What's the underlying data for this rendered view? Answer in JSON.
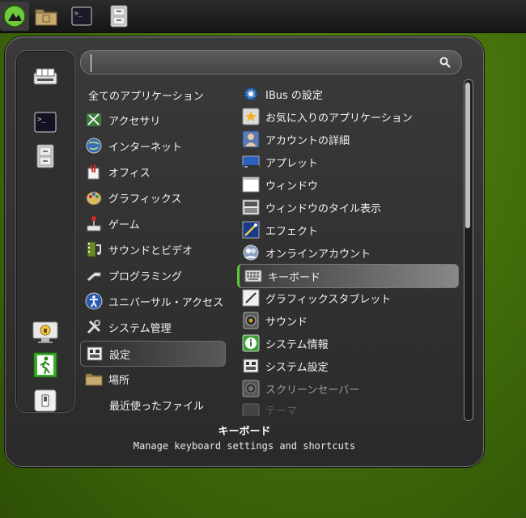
{
  "taskbar": {
    "buttons": [
      {
        "name": "menu-button",
        "icon": "mint-logo-icon"
      },
      {
        "name": "files-button",
        "icon": "folder-icon"
      },
      {
        "name": "terminal-button",
        "icon": "terminal-icon"
      },
      {
        "name": "file-cabinet-button",
        "icon": "file-cabinet-icon"
      }
    ]
  },
  "sidebar": {
    "items": [
      {
        "icon": "software-manager-icon"
      },
      {
        "icon": "terminal-icon"
      },
      {
        "icon": "file-cabinet-icon"
      },
      {
        "icon": "lock-screen-icon"
      },
      {
        "icon": "logout-icon"
      },
      {
        "icon": "shutdown-icon"
      }
    ]
  },
  "search": {
    "value": "",
    "placeholder": ""
  },
  "categories": [
    {
      "label": "全てのアプリケーション",
      "icon": ""
    },
    {
      "label": "アクセサリ",
      "icon": "accessories-icon"
    },
    {
      "label": "インターネット",
      "icon": "internet-globe-icon"
    },
    {
      "label": "オフィス",
      "icon": "office-icon"
    },
    {
      "label": "グラフィックス",
      "icon": "graphics-palette-icon"
    },
    {
      "label": "ゲーム",
      "icon": "games-joystick-icon"
    },
    {
      "label": "サウンドとビデオ",
      "icon": "multimedia-icon"
    },
    {
      "label": "プログラミング",
      "icon": "programming-icon"
    },
    {
      "label": "ユニバーサル・アクセス",
      "icon": "accessibility-icon"
    },
    {
      "label": "システム管理",
      "icon": "system-tools-icon"
    },
    {
      "label": "設定",
      "icon": "settings-icon"
    },
    {
      "label": "場所",
      "icon": "places-folder-icon"
    },
    {
      "label": "最近使ったファイル",
      "icon": ""
    }
  ],
  "apps": [
    {
      "label": "IBus の設定",
      "icon": "ibus-gear-icon"
    },
    {
      "label": "お気に入りのアプリケーション",
      "icon": "favorites-star-icon"
    },
    {
      "label": "アカウントの詳細",
      "icon": "account-icon"
    },
    {
      "label": "アプレット",
      "icon": "applets-icon"
    },
    {
      "label": "ウィンドウ",
      "icon": "window-icon"
    },
    {
      "label": "ウィンドウのタイル表示",
      "icon": "window-tiling-icon"
    },
    {
      "label": "エフェクト",
      "icon": "effects-icon"
    },
    {
      "label": "オンラインアカウント",
      "icon": "online-accounts-icon"
    },
    {
      "label": "キーボード",
      "icon": "keyboard-icon"
    },
    {
      "label": "グラフィックスタブレット",
      "icon": "tablet-icon"
    },
    {
      "label": "サウンド",
      "icon": "sound-speaker-icon"
    },
    {
      "label": "システム情報",
      "icon": "system-info-icon"
    },
    {
      "label": "システム設定",
      "icon": "system-settings-icon"
    },
    {
      "label": "スクリーンセーバー",
      "icon": "screensaver-icon"
    },
    {
      "label": "テーマ",
      "icon": "themes-icon"
    }
  ],
  "description": {
    "title": "キーボード",
    "text": "Manage keyboard settings and shortcuts"
  },
  "colors": {
    "desktop": "#4a7a0c",
    "accent_green": "#5fc93a"
  }
}
